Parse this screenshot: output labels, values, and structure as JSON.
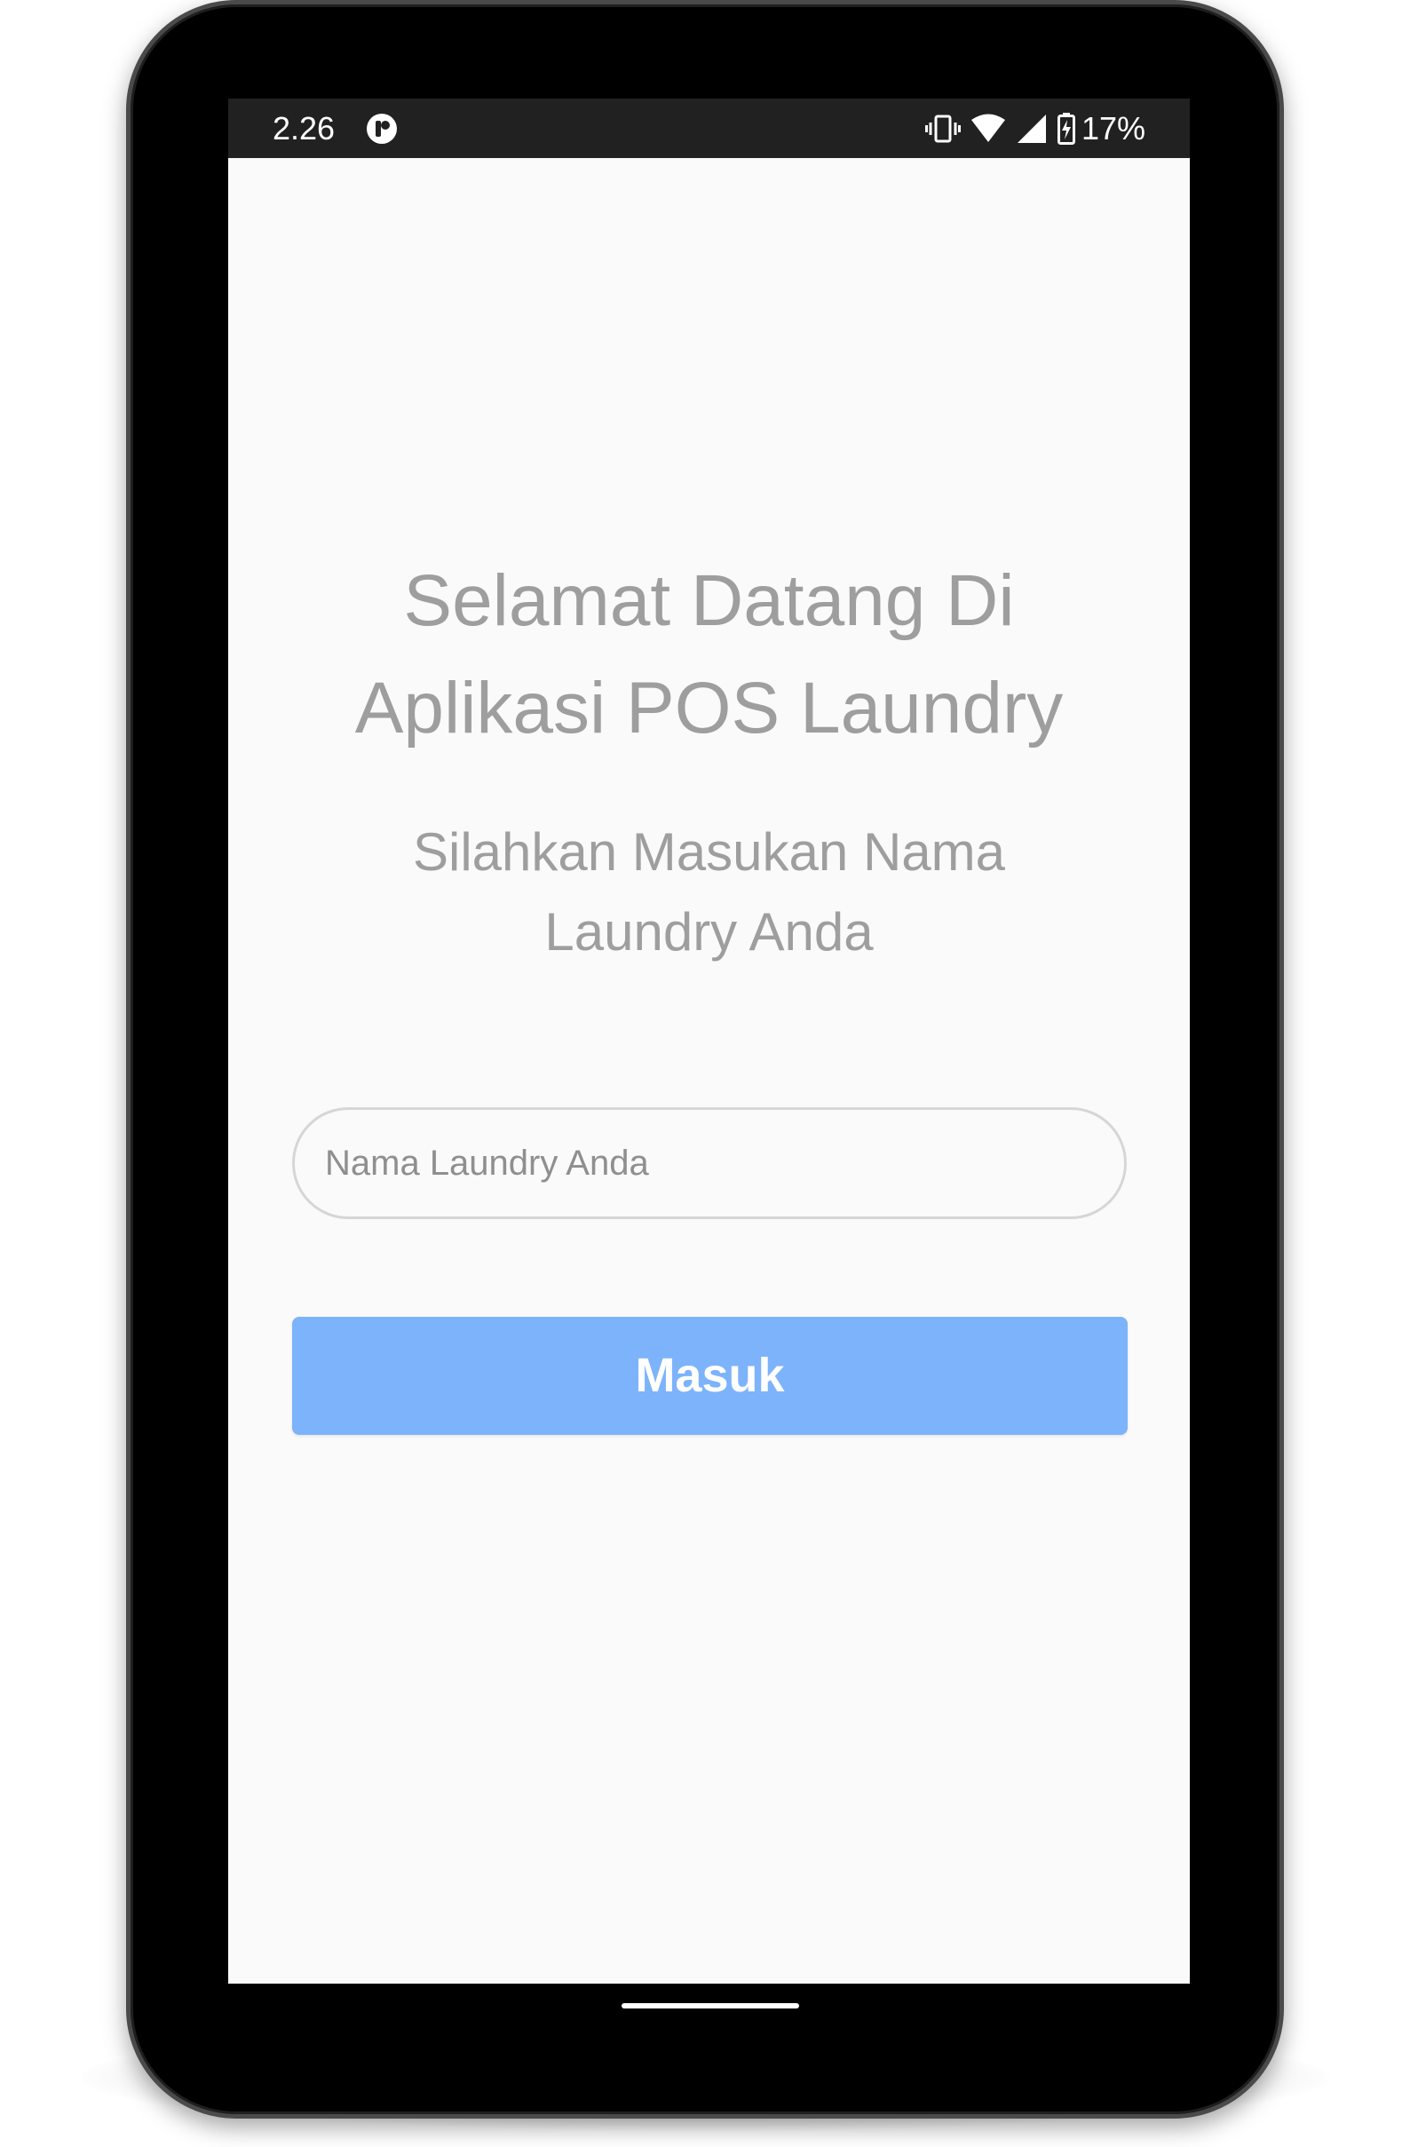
{
  "status_bar": {
    "time": "2.26",
    "battery_percent": "17%",
    "app_icon": "circle-app-icon",
    "icons": [
      "vibrate-icon",
      "wifi-icon",
      "cell-signal-icon",
      "battery-charging-icon"
    ]
  },
  "welcome": {
    "title": "Selamat Datang Di\nAplikasi POS Laundry",
    "subtitle": "Silahkan Masukan Nama\nLaundry Anda"
  },
  "form": {
    "laundry_name_placeholder": "Nama Laundry Anda",
    "laundry_name_value": "",
    "submit_label": "Masuk"
  },
  "colors": {
    "status_bar": "#212121",
    "screen_background": "#fafafa",
    "text_gray": "#9e9e9e",
    "button_blue": "#7db3fb",
    "input_border": "#d6d6d6"
  }
}
